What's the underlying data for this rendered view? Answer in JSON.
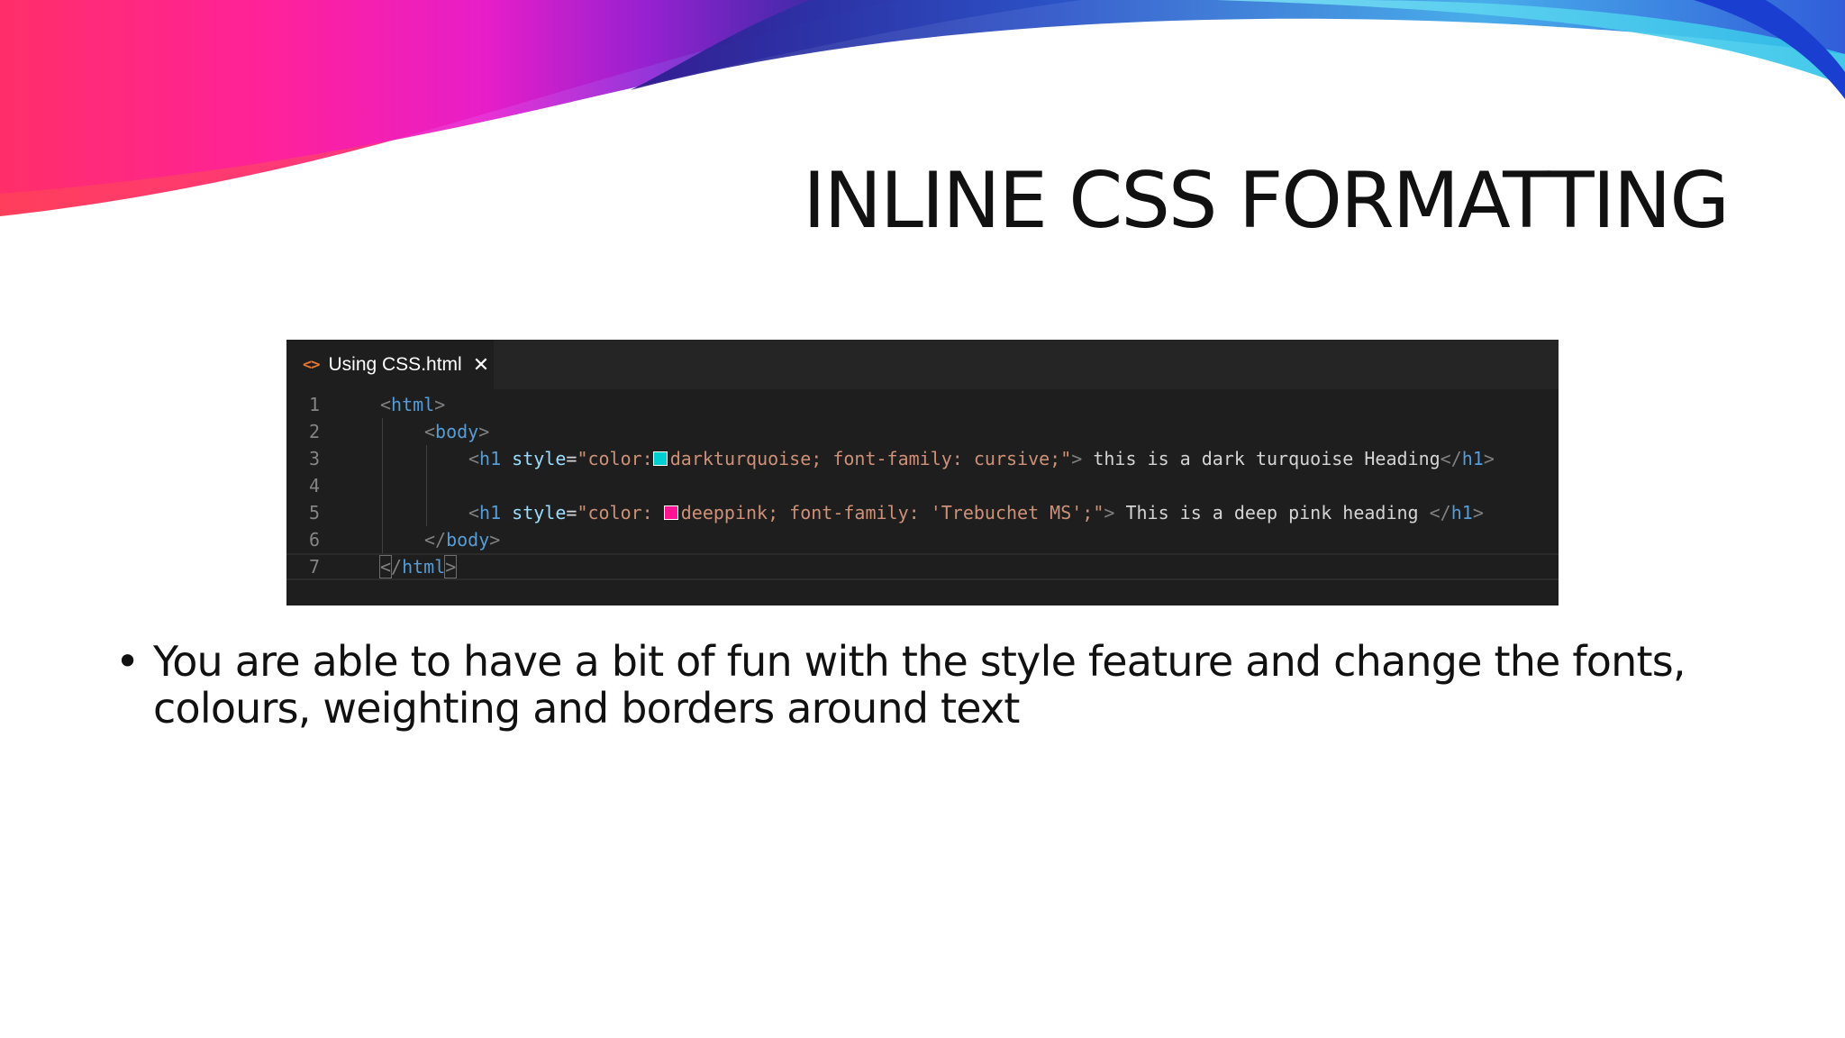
{
  "slide": {
    "title": "INLINE CSS FORMATTING",
    "bullet_mark": "•",
    "bullet_text": "You are able to have a bit of fun with the style feature and change the fonts, colours, weighting and borders around text"
  },
  "editor": {
    "tab_icon": "<>",
    "tab_title": "Using CSS.html",
    "close_glyph": "✕",
    "lines": [
      {
        "n": "1",
        "parts": [
          {
            "t": "<",
            "c": "br"
          },
          {
            "t": "html",
            "c": "tag"
          },
          {
            "t": ">",
            "c": "br"
          }
        ]
      },
      {
        "n": "2",
        "parts": [
          {
            "t": "<",
            "c": "br"
          },
          {
            "t": "body",
            "c": "tag"
          },
          {
            "t": ">",
            "c": "br"
          }
        ]
      },
      {
        "n": "3",
        "parts": [
          {
            "t": "<",
            "c": "br"
          },
          {
            "t": "h1",
            "c": "tag"
          },
          {
            "t": " style",
            "c": "attr"
          },
          {
            "t": "=",
            "c": "op"
          },
          {
            "t": "\"color:",
            "c": "str"
          },
          {
            "swatch": "#00ced1"
          },
          {
            "t": "darkturquoise; font-family: cursive;\"",
            "c": "str"
          },
          {
            "t": ">",
            "c": "br"
          },
          {
            "t": " this is a dark turquoise Heading",
            "c": "text"
          },
          {
            "t": "</",
            "c": "br"
          },
          {
            "t": "h1",
            "c": "tag"
          },
          {
            "t": ">",
            "c": "br"
          }
        ]
      },
      {
        "n": "4",
        "parts": []
      },
      {
        "n": "5",
        "parts": [
          {
            "t": "<",
            "c": "br"
          },
          {
            "t": "h1",
            "c": "tag"
          },
          {
            "t": " style",
            "c": "attr"
          },
          {
            "t": "=",
            "c": "op"
          },
          {
            "t": "\"color: ",
            "c": "str"
          },
          {
            "swatch": "#ff1493"
          },
          {
            "t": "deeppink; font-family: 'Trebuchet MS';\"",
            "c": "str"
          },
          {
            "t": ">",
            "c": "br"
          },
          {
            "t": " This is a deep pink heading ",
            "c": "text"
          },
          {
            "t": "</",
            "c": "br"
          },
          {
            "t": "h1",
            "c": "tag"
          },
          {
            "t": ">",
            "c": "br"
          }
        ]
      },
      {
        "n": "6",
        "parts": [
          {
            "t": "</",
            "c": "br"
          },
          {
            "t": "body",
            "c": "tag"
          },
          {
            "t": ">",
            "c": "br"
          }
        ]
      },
      {
        "n": "7",
        "parts": [
          {
            "t": "<",
            "c": "br",
            "hl": true
          },
          {
            "t": "/",
            "c": "br"
          },
          {
            "t": "html",
            "c": "tag"
          },
          {
            "t": ">",
            "c": "br",
            "hl": true
          }
        ]
      }
    ],
    "indent_levels": [
      0,
      1,
      2,
      2,
      2,
      1,
      0
    ],
    "current_line": 7
  },
  "colors": {
    "editor_bg": "#1e1e1e",
    "tab_bar_bg": "#252526",
    "swatch_turquoise": "#00ced1",
    "swatch_deeppink": "#ff1493",
    "title_text": "#111111"
  }
}
